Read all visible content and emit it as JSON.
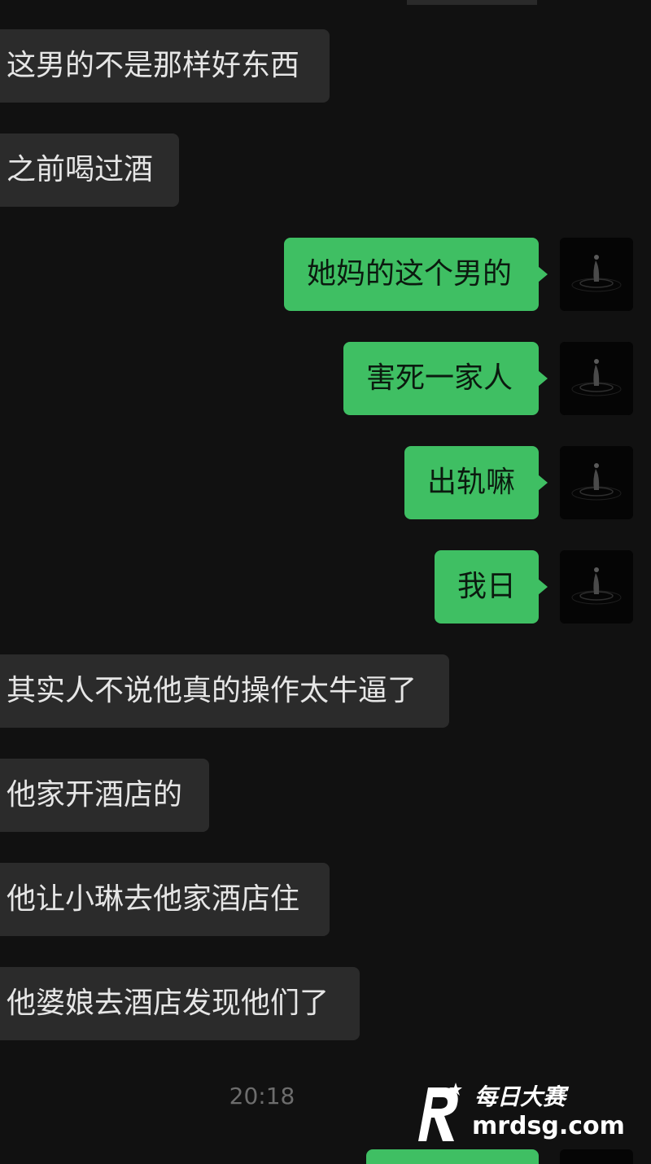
{
  "chat": {
    "messages": [
      {
        "side": "in",
        "text": "这男的不是那样好东西"
      },
      {
        "side": "in",
        "text": "之前喝过酒"
      },
      {
        "side": "out",
        "text": "她妈的这个男的"
      },
      {
        "side": "out",
        "text": "害死一家人"
      },
      {
        "side": "out",
        "text": "出轨嘛"
      },
      {
        "side": "out",
        "text": "我日"
      },
      {
        "side": "in",
        "text": "其实人不说他真的操作太牛逼了"
      },
      {
        "side": "in",
        "text": "他家开酒店的"
      },
      {
        "side": "in",
        "text": "他让小琳去他家酒店住"
      },
      {
        "side": "in",
        "text": "他婆娘去酒店发现他们了"
      }
    ],
    "timestamp": "20:18"
  },
  "colors": {
    "background": "#111111",
    "incoming_bubble": "#2b2b2b",
    "outgoing_bubble": "#3fbf63",
    "incoming_text": "#e6e6e6",
    "outgoing_text": "#0b1a0f",
    "timestamp_text": "#6d6d6d"
  },
  "icons": {
    "avatar": "water-droplet-avatar-icon"
  },
  "watermark": {
    "logo_letter": "R",
    "brand_cn": "每日大赛",
    "domain": "mrdsg.com"
  }
}
